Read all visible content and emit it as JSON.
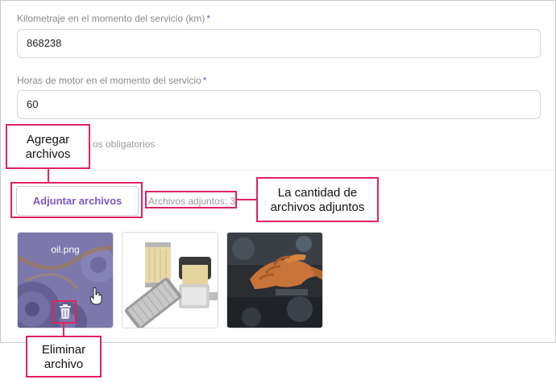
{
  "form": {
    "mileage": {
      "label": "Kilometraje en el momento del servicio (km)",
      "required_mark": "*",
      "value": "868238"
    },
    "engine_hours": {
      "label": "Horas de motor en el momento del servicio",
      "required_mark": "*",
      "value": "60"
    },
    "required_note": "os obligatorios"
  },
  "attachments": {
    "button_label": "Adjuntar archivos",
    "count_label": "Archivos adjuntos: 3",
    "files": [
      {
        "name": "oil.png",
        "hovered": true
      },
      {
        "name": ""
      },
      {
        "name": ""
      }
    ]
  },
  "callouts": {
    "add_files": [
      "Agregar",
      "archivos"
    ],
    "file_count": [
      "La cantidad de",
      "archivos adjuntos"
    ],
    "delete_file": [
      "Eliminar",
      "archivo"
    ]
  },
  "colors": {
    "accent": "#7b57c4",
    "callout_border": "#e0245e"
  }
}
